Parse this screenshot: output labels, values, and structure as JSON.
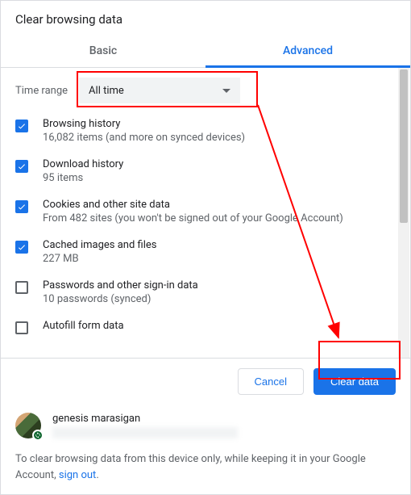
{
  "dialog": {
    "title": "Clear browsing data"
  },
  "tabs": {
    "basic": "Basic",
    "advanced": "Advanced"
  },
  "timeRange": {
    "label": "Time range",
    "value": "All time"
  },
  "items": [
    {
      "checked": true,
      "title": "Browsing history",
      "subtitle": "16,082 items (and more on synced devices)"
    },
    {
      "checked": true,
      "title": "Download history",
      "subtitle": "95 items"
    },
    {
      "checked": true,
      "title": "Cookies and other site data",
      "subtitle": "From 482 sites (you won't be signed out of your Google Account)"
    },
    {
      "checked": true,
      "title": "Cached images and files",
      "subtitle": "227 MB"
    },
    {
      "checked": false,
      "title": "Passwords and other sign-in data",
      "subtitle": "10 passwords (synced)"
    },
    {
      "checked": false,
      "title": "Autofill form data",
      "subtitle": ""
    }
  ],
  "footer": {
    "cancel": "Cancel",
    "clear": "Clear data"
  },
  "account": {
    "name": "genesis marasigan"
  },
  "note": {
    "text": "To clear browsing data from this device only, while keeping it in your Google Account, ",
    "link": "sign out",
    "suffix": "."
  }
}
